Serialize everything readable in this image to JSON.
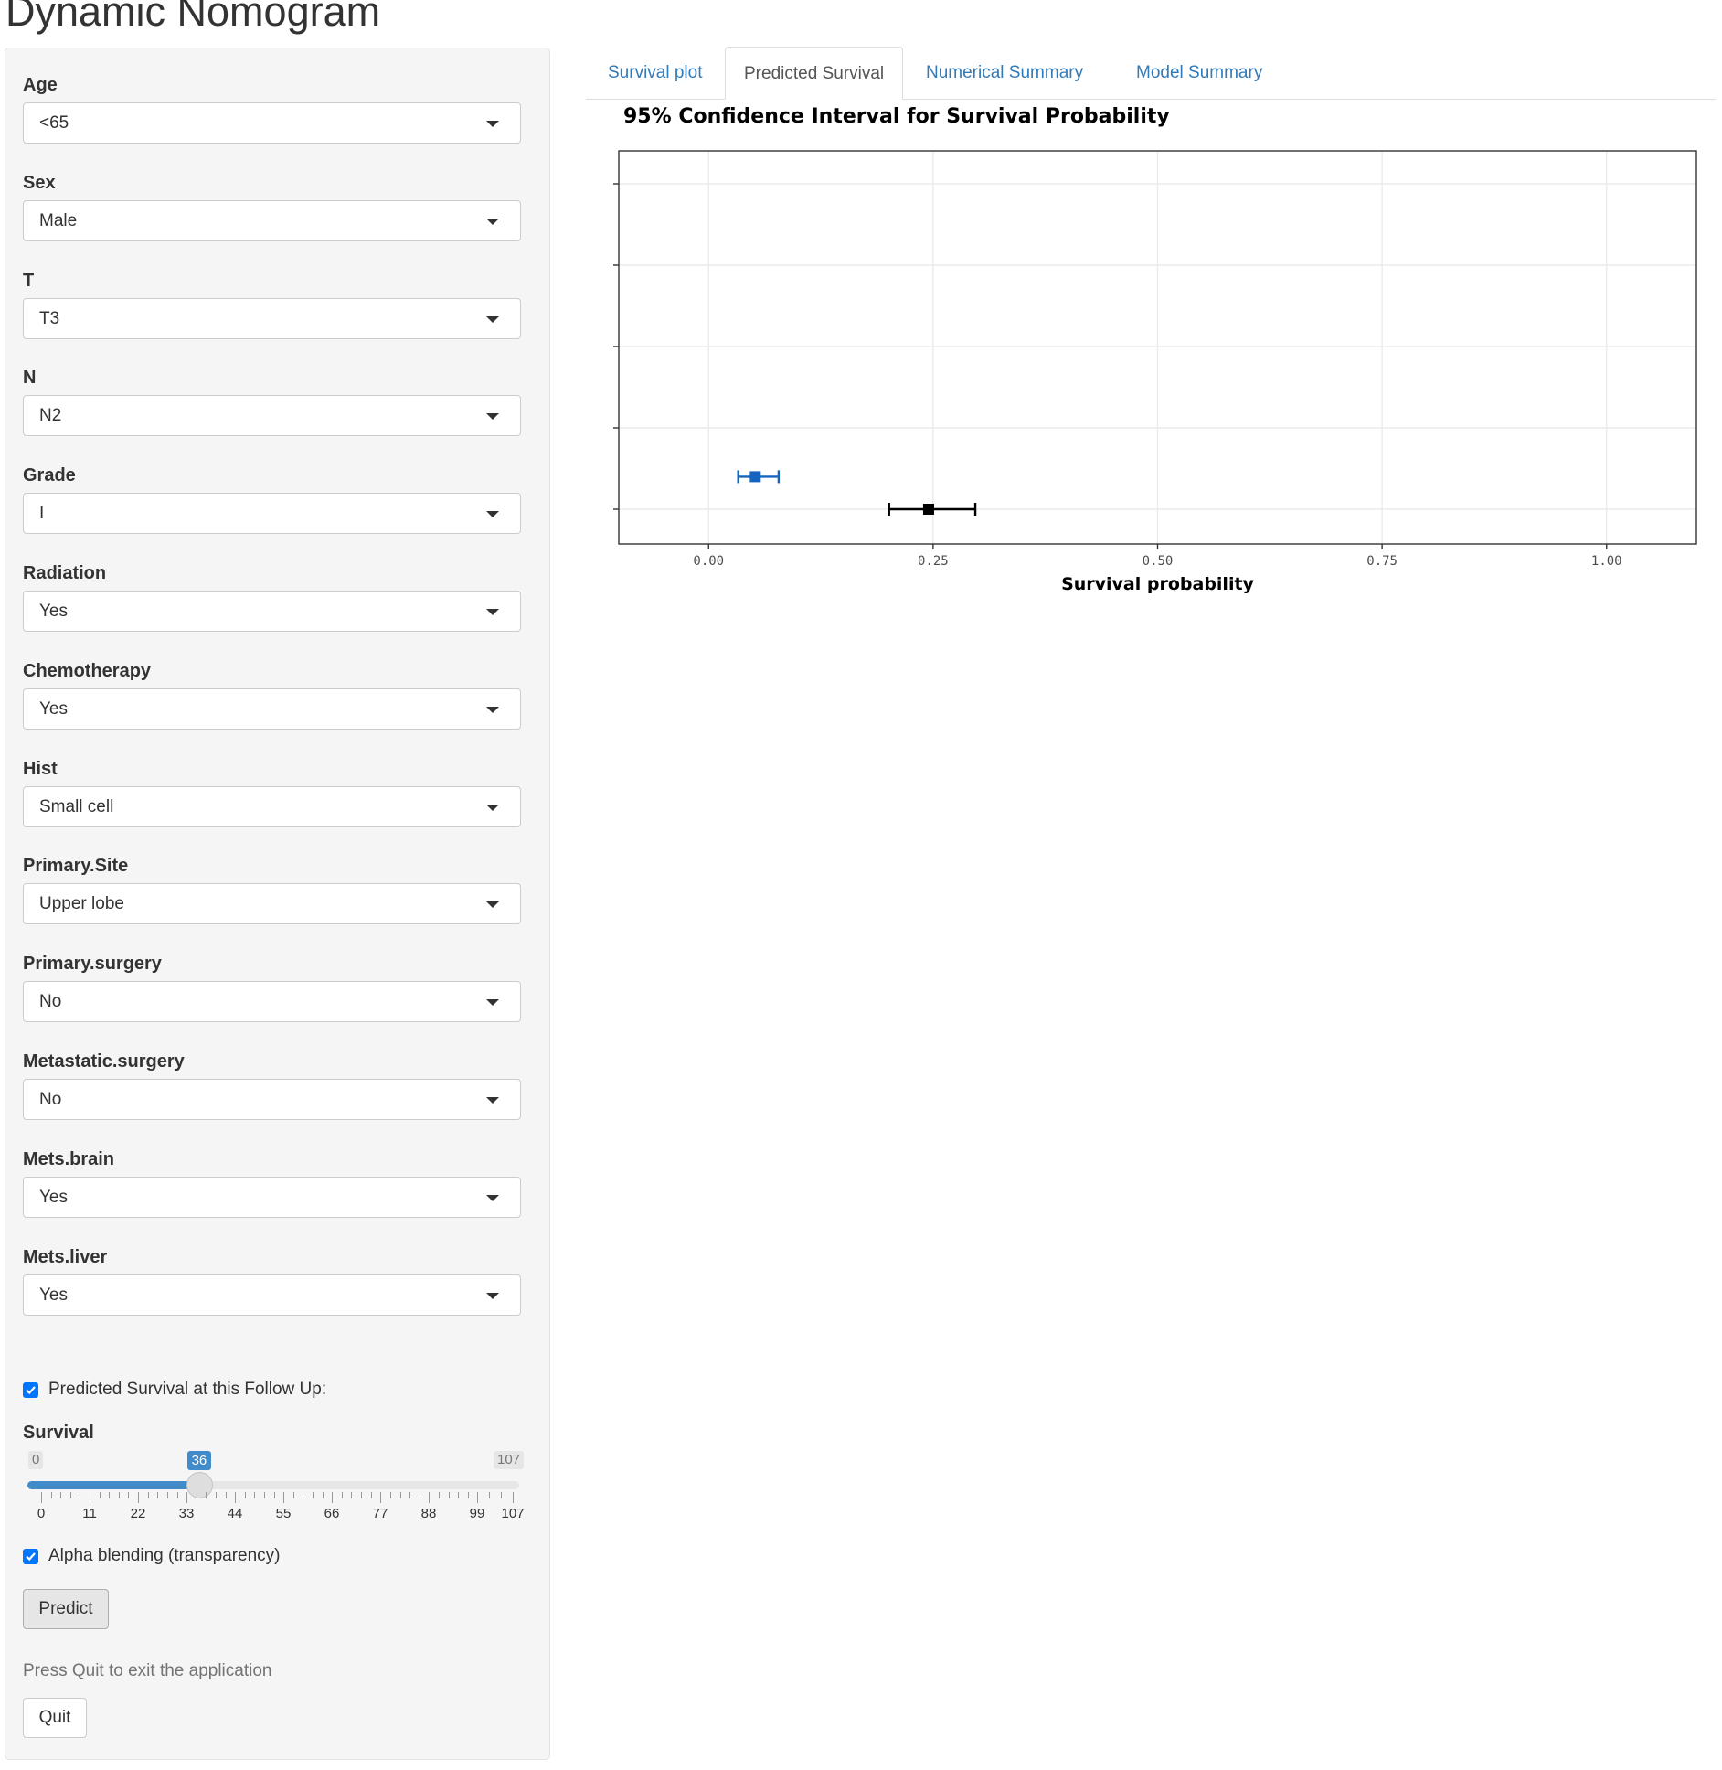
{
  "app": {
    "title": "Dynamic Nomogram"
  },
  "sidebar": {
    "fields": [
      {
        "label": "Age",
        "value": "<65"
      },
      {
        "label": "Sex",
        "value": "Male"
      },
      {
        "label": "T",
        "value": "T3"
      },
      {
        "label": "N",
        "value": "N2"
      },
      {
        "label": "Grade",
        "value": "I"
      },
      {
        "label": "Radiation",
        "value": "Yes"
      },
      {
        "label": "Chemotherapy",
        "value": "Yes"
      },
      {
        "label": "Hist",
        "value": "Small cell"
      },
      {
        "label": "Primary.Site",
        "value": "Upper lobe"
      },
      {
        "label": "Primary.surgery",
        "value": "No"
      },
      {
        "label": "Metastatic.surgery",
        "value": "No"
      },
      {
        "label": "Mets.brain",
        "value": "Yes"
      },
      {
        "label": "Mets.liver",
        "value": "Yes"
      }
    ],
    "followup_checkbox": {
      "label": "Predicted Survival at this Follow Up:",
      "checked": true
    },
    "survival_slider": {
      "label": "Survival",
      "min": 0,
      "max": 107,
      "value": 36,
      "tick_labels": [
        "0",
        "11",
        "22",
        "33",
        "44",
        "55",
        "66",
        "77",
        "88",
        "99",
        "107"
      ]
    },
    "alpha_checkbox": {
      "label": "Alpha blending (transparency)",
      "checked": true
    },
    "predict_button": "Predict",
    "help_text": "Press Quit to exit the application",
    "quit_button": "Quit"
  },
  "tabs": [
    {
      "label": "Survival plot",
      "active": false
    },
    {
      "label": "Predicted Survival",
      "active": true
    },
    {
      "label": "Numerical Summary",
      "active": false
    },
    {
      "label": "Model Summary",
      "active": false
    }
  ],
  "chart_data": {
    "type": "scatter",
    "title": "95% Confidence Interval for Survival Probability",
    "xlabel": "Survival probability",
    "ylabel": "",
    "xlim": [
      -0.1,
      1.1
    ],
    "x_ticks": [
      "0.00",
      "0.25",
      "0.50",
      "0.75",
      "1.00"
    ],
    "y_ticks": [
      "",
      "",
      "",
      "",
      ""
    ],
    "grid": true,
    "legend": "none",
    "series": [
      {
        "color": "#1565c0",
        "points": [
          {
            "y_slot": 1.4,
            "estimate": 0.052,
            "lower": 0.033,
            "upper": 0.078
          }
        ]
      },
      {
        "color": "#000000",
        "points": [
          {
            "y_slot": 1,
            "estimate": 0.245,
            "lower": 0.201,
            "upper": 0.297
          }
        ]
      }
    ]
  },
  "colors": {
    "accent": "#428bca",
    "checkbox": "#0075ff",
    "link": "#337ab7",
    "panel_bg": "#f5f5f5"
  }
}
